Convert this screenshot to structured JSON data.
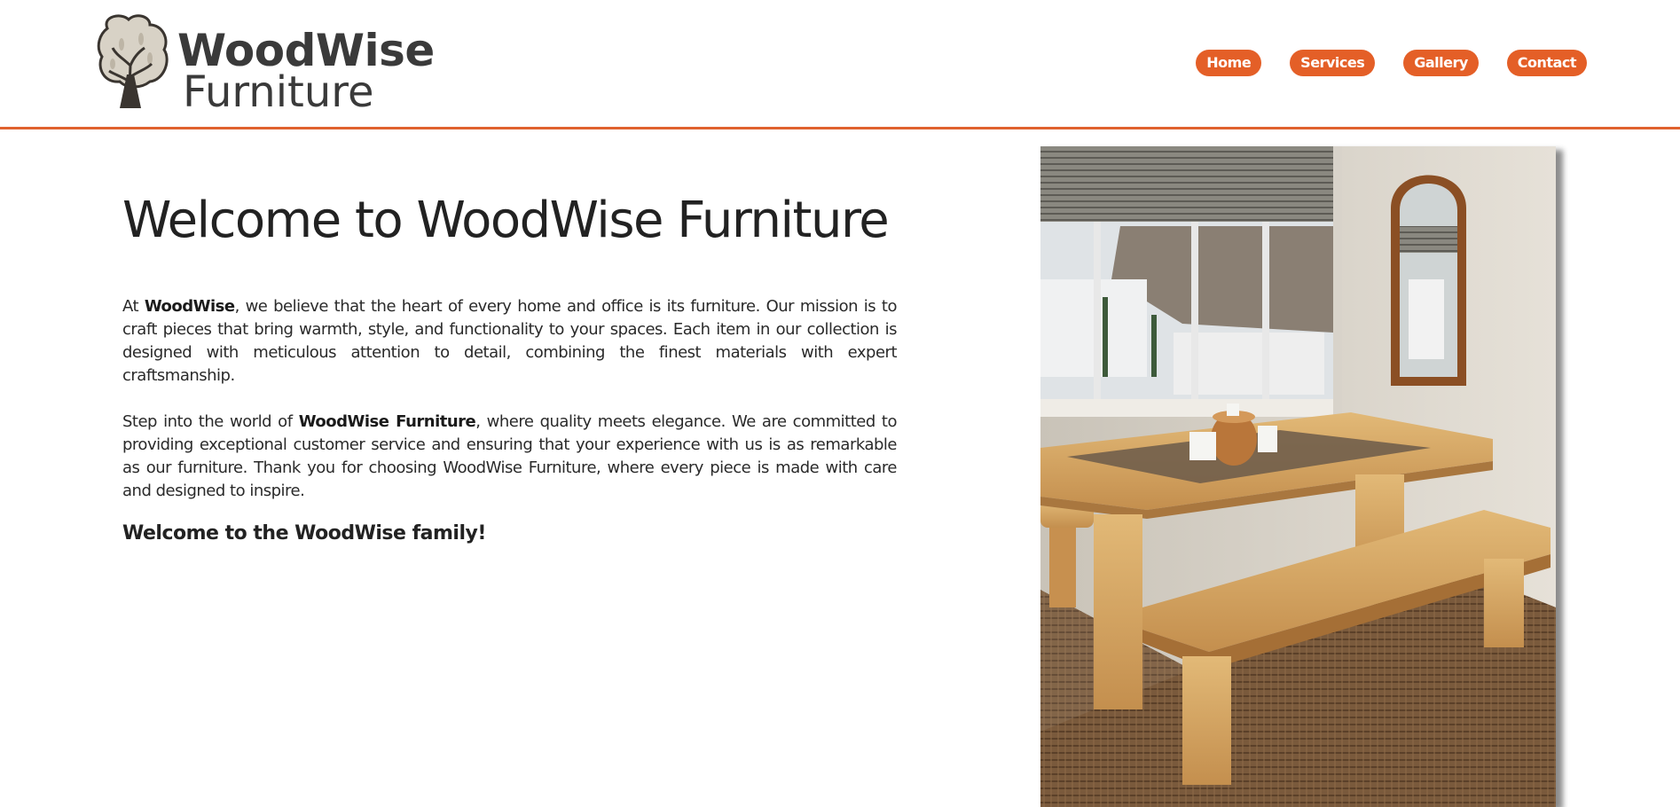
{
  "brand": {
    "name_top": "WoodWise",
    "name_bottom": "Furniture",
    "logo_icon": "tree-icon"
  },
  "nav": {
    "items": [
      "Home",
      "Services",
      "Gallery",
      "Contact"
    ]
  },
  "colors": {
    "accent": "#e45f27",
    "header_rule": "#e0622e",
    "text": "#222222"
  },
  "main": {
    "title": "Welcome to WoodWise Furniture",
    "p1": {
      "lead": "At ",
      "bold": "WoodWise",
      "rest": ", we believe that the heart of every home and office is its furniture. Our mission is to craft pieces that bring warmth, style, and functionality to your spaces. Each item in our collection is designed with meticulous attention to detail, combining the finest materials with expert craftsmanship."
    },
    "p2": {
      "lead": "Step into the world of ",
      "bold": "WoodWise Furniture",
      "rest": ", where quality meets elegance. We are committed to providing exceptional customer service and ensuring that your experience with us is as remarkable as our furniture. Thank you for choosing WoodWise Furniture, where every piece is made with care and designed to inspire."
    },
    "closing": "Welcome to the WoodWise family!"
  },
  "photo": {
    "subject": "wooden-dining-table-and-bench-photo"
  }
}
